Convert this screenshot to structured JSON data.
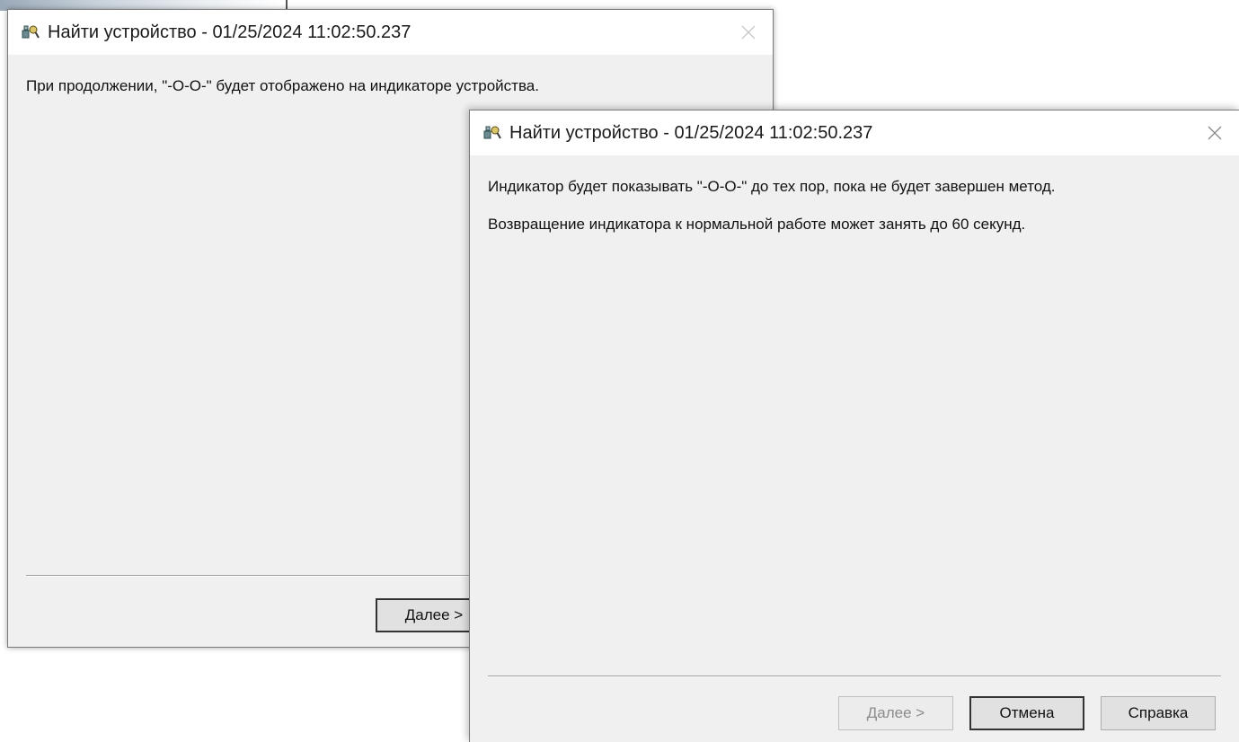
{
  "back_dialog": {
    "title": "Найти устройство - 01/25/2024 11:02:50.237",
    "message": "При продолжении, \"-О-О-\" будет отображено на индикаторе устройства.",
    "next_label": "Далее >",
    "icon": "device-finder-icon"
  },
  "front_dialog": {
    "title": "Найти устройство - 01/25/2024 11:02:50.237",
    "message_1": "Индикатор будет показывать \"-О-О-\" до тех пор, пока не будет завершен метод.",
    "message_2": "Возвращение индикатора к нормальной работе может занять до 60 секунд.",
    "next_label": "Далее >",
    "cancel_label": "Отмена",
    "help_label": "Справка",
    "icon": "device-finder-icon",
    "next_disabled": true
  }
}
